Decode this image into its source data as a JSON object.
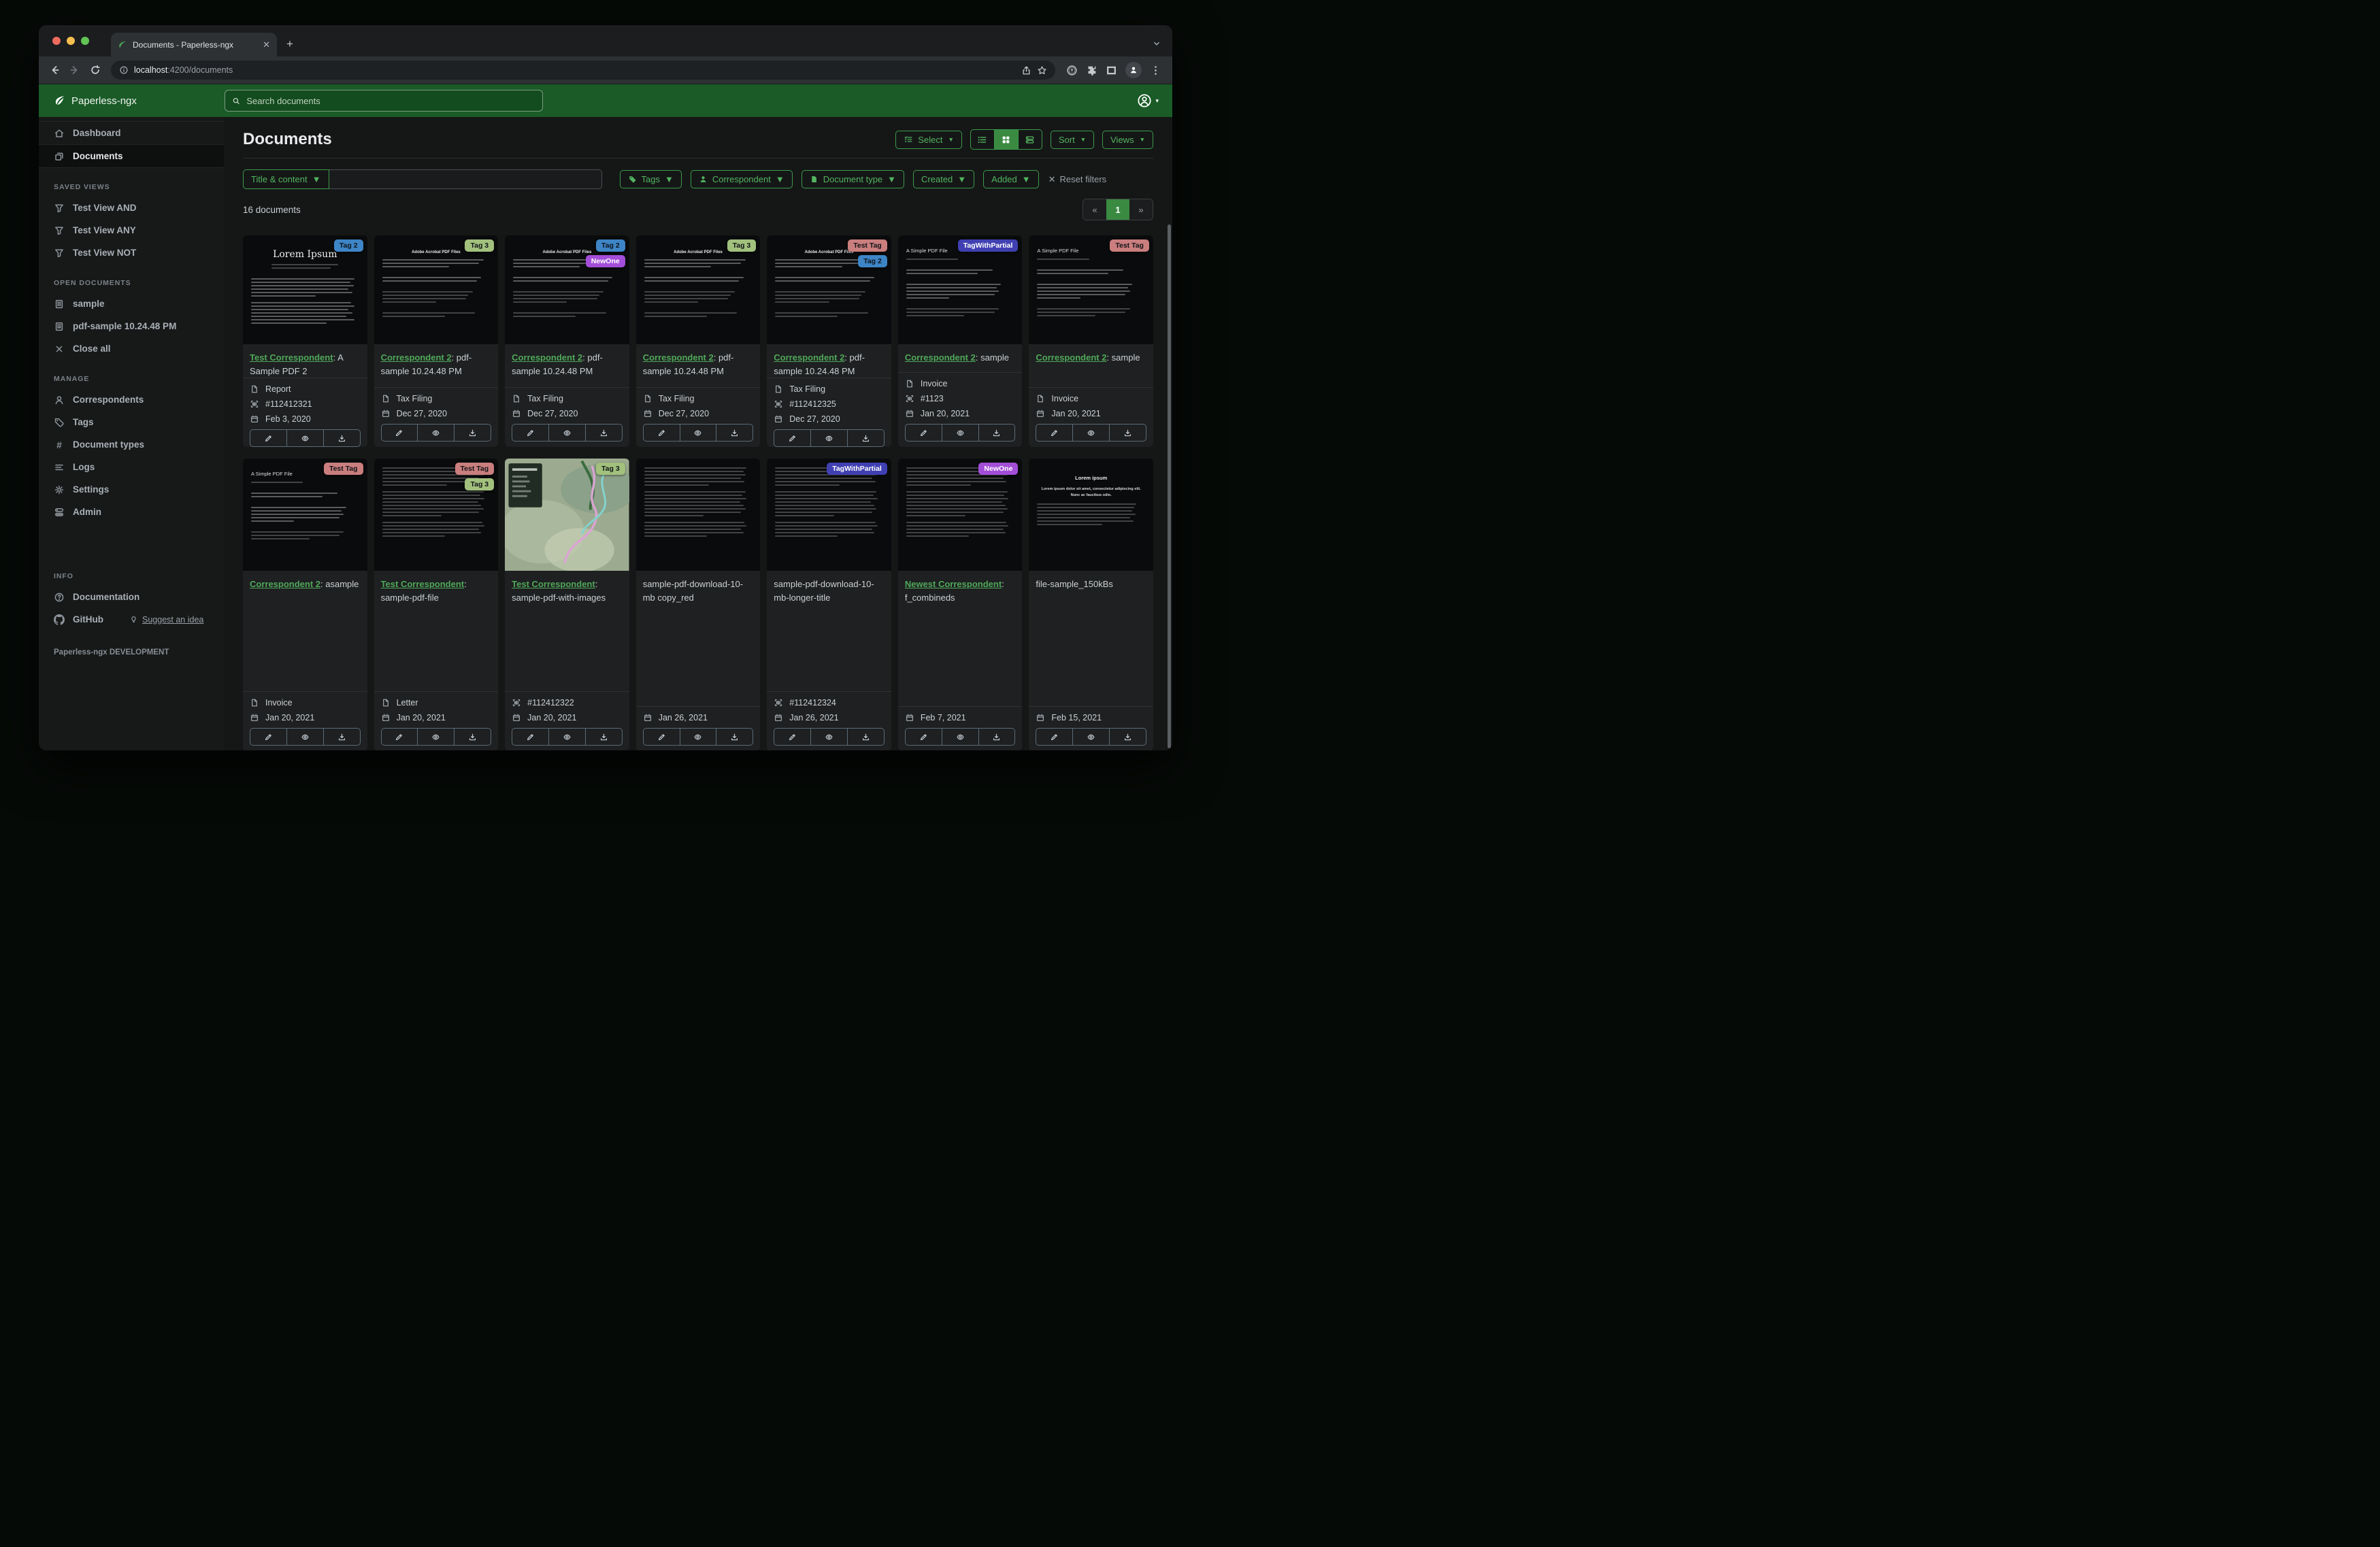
{
  "browser": {
    "tab_title": "Documents - Paperless-ngx",
    "url_host": "localhost",
    "url_rest": ":4200/documents"
  },
  "header": {
    "brand": "Paperless-ngx",
    "search_placeholder": "Search documents"
  },
  "sidebar": {
    "nav": [
      {
        "icon": "home",
        "label": "Dashboard",
        "active": false
      },
      {
        "icon": "docs",
        "label": "Documents",
        "active": true
      }
    ],
    "sections": [
      {
        "label": "SAVED VIEWS",
        "items": [
          {
            "icon": "funnel",
            "label": "Test View AND"
          },
          {
            "icon": "funnel",
            "label": "Test View ANY"
          },
          {
            "icon": "funnel",
            "label": "Test View NOT"
          }
        ]
      },
      {
        "label": "OPEN DOCUMENTS",
        "items": [
          {
            "icon": "docfile",
            "label": "sample"
          },
          {
            "icon": "docfile",
            "label": "pdf-sample 10.24.48 PM"
          },
          {
            "icon": "close",
            "label": "Close all"
          }
        ]
      },
      {
        "label": "MANAGE",
        "items": [
          {
            "icon": "person",
            "label": "Correspondents"
          },
          {
            "icon": "tag",
            "label": "Tags"
          },
          {
            "icon": "hash",
            "label": "Document types"
          },
          {
            "icon": "lines",
            "label": "Logs"
          },
          {
            "icon": "gear",
            "label": "Settings"
          },
          {
            "icon": "toggles",
            "label": "Admin"
          }
        ]
      },
      {
        "label": "INFO",
        "items": [
          {
            "icon": "question",
            "label": "Documentation"
          },
          {
            "icon": "github",
            "label": "GitHub",
            "extra": {
              "icon": "bulb",
              "label": "Suggest an idea"
            }
          }
        ]
      }
    ],
    "footer": "Paperless-ngx DEVELOPMENT"
  },
  "page": {
    "title": "Documents",
    "select_label": "Select",
    "sort_label": "Sort",
    "views_label": "Views"
  },
  "filters": {
    "field_label": "Title & content",
    "input_value": "",
    "buttons": [
      {
        "label": "Tags",
        "icon": "tag-solid"
      },
      {
        "label": "Correspondent",
        "icon": "person-solid"
      },
      {
        "label": "Document type",
        "icon": "file-solid"
      },
      {
        "label": "Created"
      },
      {
        "label": "Added"
      }
    ],
    "reset_label": "Reset filters"
  },
  "results": {
    "count": "16 documents",
    "page": "1",
    "prev": "«",
    "next": "»"
  },
  "accent": {
    "green": "#3c9a49",
    "link_green": "#50a85a"
  },
  "tag_defs": {
    "tag2": {
      "label": "Tag 2",
      "bg": "#3d85c6",
      "fg": "#101418"
    },
    "tag3": {
      "label": "Tag 3",
      "bg": "#a2c17d",
      "fg": "#101418"
    },
    "newone": {
      "label": "NewOne",
      "bg": "#a34ed8",
      "fg": "#ffffff"
    },
    "testtag": {
      "label": "Test Tag",
      "bg": "#ca7e7e",
      "fg": "#101418"
    },
    "tagwithpartial": {
      "label": "TagWithPartial",
      "bg": "#4040b2",
      "fg": "#ffffff"
    }
  },
  "thumbs": {
    "lorem_serif_title": "Lorem Ipsum",
    "acrobat_title": "Adobe Acrobat PDF Files",
    "simple_title": "A Simple PDF File",
    "sans_title": "Lorem ipsum",
    "sans_sub": "Lorem ipsum dolor sit amet, consectetur adipiscing elit. Nunc ac faucibus odio."
  },
  "documents": [
    {
      "variant": "lorem-serif",
      "tags": [
        "tag2"
      ],
      "correspondent": "Test Correspondent",
      "title": "A Sample PDF 2",
      "type": "Report",
      "asn": "#112412321",
      "date": "Feb 3, 2020"
    },
    {
      "variant": "acrobat",
      "tags": [
        "tag3"
      ],
      "correspondent": "Correspondent 2",
      "title": "pdf-sample 10.24.48 PM",
      "type": "Tax Filing",
      "asn": "",
      "date": "Dec 27, 2020"
    },
    {
      "variant": "acrobat",
      "tags": [
        "tag2",
        "newone"
      ],
      "correspondent": "Correspondent 2",
      "title": "pdf-sample 10.24.48 PM",
      "type": "Tax Filing",
      "asn": "",
      "date": "Dec 27, 2020"
    },
    {
      "variant": "acrobat",
      "tags": [
        "tag3"
      ],
      "correspondent": "Correspondent 2",
      "title": "pdf-sample 10.24.48 PM",
      "type": "Tax Filing",
      "asn": "",
      "date": "Dec 27, 2020"
    },
    {
      "variant": "acrobat",
      "tags": [
        "testtag",
        "tag2"
      ],
      "correspondent": "Correspondent 2",
      "title": "pdf-sample 10.24.48 PM",
      "type": "Tax Filing",
      "asn": "#112412325",
      "date": "Dec 27, 2020"
    },
    {
      "variant": "simple",
      "tags": [
        "tagwithpartial"
      ],
      "correspondent": "Correspondent 2",
      "title": "sample",
      "type": "Invoice",
      "asn": "#1123",
      "date": "Jan 20, 2021"
    },
    {
      "variant": "simple",
      "tags": [
        "testtag"
      ],
      "correspondent": "Correspondent 2",
      "title": "sample",
      "type": "Invoice",
      "asn": "",
      "date": "Jan 20, 2021"
    },
    {
      "variant": "simple",
      "tags": [
        "testtag"
      ],
      "correspondent": "Correspondent 2",
      "title": "asample",
      "type": "Invoice",
      "asn": "",
      "date": "Jan 20, 2021"
    },
    {
      "variant": "dense",
      "tags": [
        "testtag",
        "tag3"
      ],
      "correspondent": "Test Correspondent",
      "title": "sample-pdf-file",
      "type": "Letter",
      "asn": "",
      "date": "Jan 20, 2021"
    },
    {
      "variant": "map",
      "tags": [
        "tag3"
      ],
      "correspondent": "Test Correspondent",
      "title": "sample-pdf-with-images",
      "type": "",
      "asn": "#112412322",
      "date": "Jan 20, 2021"
    },
    {
      "variant": "dense",
      "tags": [],
      "correspondent": "",
      "title": "sample-pdf-download-10-mb copy_red",
      "type": "",
      "asn": "",
      "date": "Jan 26, 2021"
    },
    {
      "variant": "dense",
      "tags": [
        "tagwithpartial"
      ],
      "correspondent": "",
      "title": "sample-pdf-download-10-mb-longer-title",
      "type": "",
      "asn": "#112412324",
      "date": "Jan 26, 2021"
    },
    {
      "variant": "dense",
      "tags": [
        "newone"
      ],
      "correspondent": "Newest Correspondent",
      "title": "f_combineds",
      "type": "",
      "asn": "",
      "date": "Feb 7, 2021"
    },
    {
      "variant": "lorem-sans",
      "tags": [],
      "correspondent": "",
      "title": "file-sample_150kBs",
      "type": "",
      "asn": "",
      "date": "Feb 15, 2021"
    }
  ]
}
